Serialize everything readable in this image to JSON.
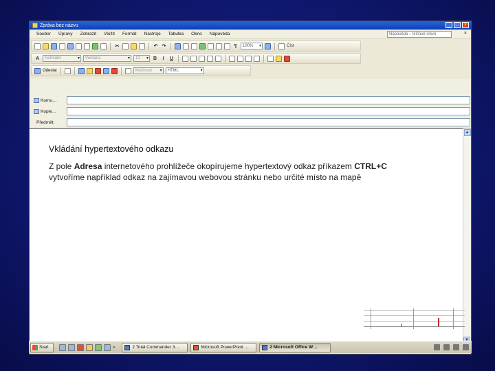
{
  "window": {
    "title": "Zpráva bez názvu",
    "controls": [
      "_",
      "□",
      "×"
    ]
  },
  "menubar": {
    "items": [
      "Soubor",
      "Úpravy",
      "Zobrazit",
      "Vložit",
      "Formát",
      "Nástroje",
      "Tabulka",
      "Okno",
      "Nápověda"
    ],
    "help_search_placeholder": "Nápověda – klíčové slovo",
    "close_symbol": "×"
  },
  "toolbar_standard": {
    "zoom": "100%",
    "read_label": "Číst"
  },
  "toolbar_format": {
    "style": "Normální",
    "font": "Verdana",
    "size": "12"
  },
  "toolbar_mail": {
    "send_label": "Odeslat",
    "options_label": "Možnosti",
    "format": "HTML"
  },
  "header": {
    "to_label": "Komu…",
    "cc_label": "Kopie…",
    "subject_label": "Předmět:",
    "to_value": "",
    "cc_value": "",
    "subject_value": ""
  },
  "document": {
    "heading": "Vkládání hypertextového odkazu",
    "line1_prefix": "Z pole ",
    "line1_bold": "Adresa",
    "line1_mid": " internetového prohlížeče okopírujeme hypertextový odkaz příkazem ",
    "line1_bold2": "CTRL+C",
    "line2": "vytvoříme například odkaz na zajímavou webovou stránku nebo určité místo na mapě"
  },
  "taskbar": {
    "start_label": "Start",
    "tasks": [
      {
        "label": "2 Total Commander 3…",
        "active": false
      },
      {
        "label": "Microsoft PowerPoint …",
        "active": false
      },
      {
        "label": "2 Microsoft Office W…",
        "active": true
      }
    ],
    "chevron": "»"
  }
}
